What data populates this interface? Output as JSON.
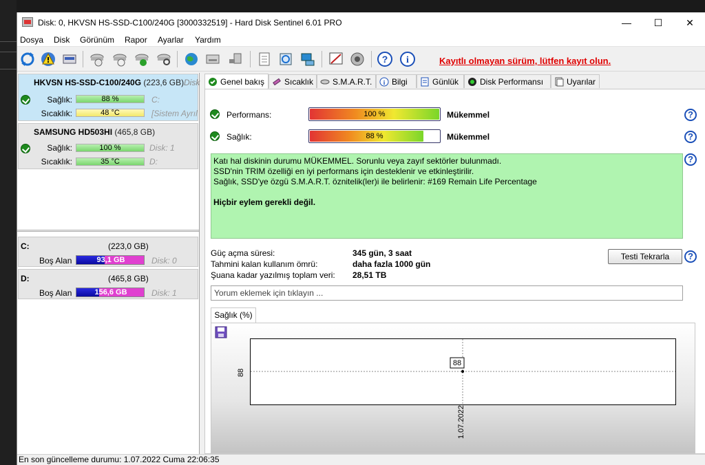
{
  "window": {
    "title": "Disk: 0, HKVSN HS-SSD-C100/240G [3000332519]  -  Hard Disk Sentinel 6.01 PRO",
    "minimize": "—",
    "maximize": "☐",
    "close": "✕"
  },
  "menu": [
    "Dosya",
    "Disk",
    "Görünüm",
    "Rapor",
    "Ayarlar",
    "Yardım"
  ],
  "toolbar": {
    "warning": "Kayıtlı olmayan sürüm, lütfen kayıt olun.",
    "icons": [
      "refresh-icon",
      "alert-icon",
      "disk-icon",
      "disk-info-icon",
      "disk-temp-icon",
      "disk-ok-icon",
      "disk-search-icon",
      "globe-icon",
      "server-icon",
      "network-disk-icon",
      "report-icon",
      "update-icon",
      "network-icon",
      "settings-icon",
      "sound-icon",
      "help-icon",
      "info-icon"
    ]
  },
  "disks": [
    {
      "name": "HKVSN HS-SSD-C100/240G",
      "size": "(223,6 GB)",
      "trunc": "Disk",
      "health_label": "Sağlık:",
      "health": "88 %",
      "health_pct": 88,
      "health_side": "C:",
      "temp_label": "Sıcaklık:",
      "temp": "48 °C",
      "temp_side": "[Sistem Ayrıl"
    },
    {
      "name": "SAMSUNG HD503HI",
      "size": "(465,8 GB)",
      "health_label": "Sağlık:",
      "health": "100 %",
      "health_pct": 100,
      "health_side": "Disk: 1",
      "temp_label": "Sıcaklık:",
      "temp": "35 °C",
      "temp_side": "D:"
    }
  ],
  "volumes": [
    {
      "letter": "C:",
      "size": "(223,0 GB)",
      "free_label": "Boş Alan",
      "free": "93,1 GB",
      "free_pct": 42,
      "disk": "Disk: 0"
    },
    {
      "letter": "D:",
      "size": "(465,8 GB)",
      "free_label": "Boş Alan",
      "free": "156,6 GB",
      "free_pct": 34,
      "disk": "Disk: 1"
    }
  ],
  "tabs": [
    "Genel bakış",
    "Sıcaklık",
    "S.M.A.R.T.",
    "Bilgi",
    "Günlük",
    "Disk Performansı",
    "Uyarılar"
  ],
  "overview": {
    "performance_label": "Performans:",
    "performance": "100 %",
    "performance_pct": 100,
    "performance_word": "Mükemmel",
    "health_label": "Sağlık:",
    "health": "88 %",
    "health_pct": 88,
    "health_word": "Mükemmel",
    "status_lines": [
      "Katı hal diskinin durumu MÜKEMMEL. Sorunlu veya zayıf sektörler bulunmadı.",
      "SSD'nin TRIM özelliği en iyi performans için desteklenir ve etkinleştirilir.",
      "Sağlık, SSD'ye özgü S.M.A.R.T. öznitelik(ler)i ile belirlenir:  #169 Remain Life Percentage"
    ],
    "status_action": "Hiçbir eylem gerekli değil.",
    "info": [
      {
        "label": "Güç açma süresi:",
        "value": "345 gün, 3 saat"
      },
      {
        "label": "Tahmini kalan kullanım ömrü:",
        "value": "daha fazla 1000 gün"
      },
      {
        "label": "Şuana kadar yazılmış toplam veri:",
        "value": "28,51 TB"
      }
    ],
    "retest_button": "Testi Tekrarla",
    "comment_placeholder": "Yorum eklemek için tıklayın ..."
  },
  "graph_tab": "Sağlık (%)",
  "chart_data": {
    "type": "scatter",
    "x": [
      "1.07.2022"
    ],
    "values": [
      88
    ],
    "y_tick": "88",
    "x_tick": "1.07.2022",
    "point_label": "88"
  },
  "status_bar": "En son güncelleme durumu: 1.07.2022 Cuma 22:06:35",
  "colors": {
    "accent": "#1a4fb8",
    "warning": "#e00000",
    "status_bg": "#b0f4b0",
    "selected": "#c7e6f7"
  }
}
